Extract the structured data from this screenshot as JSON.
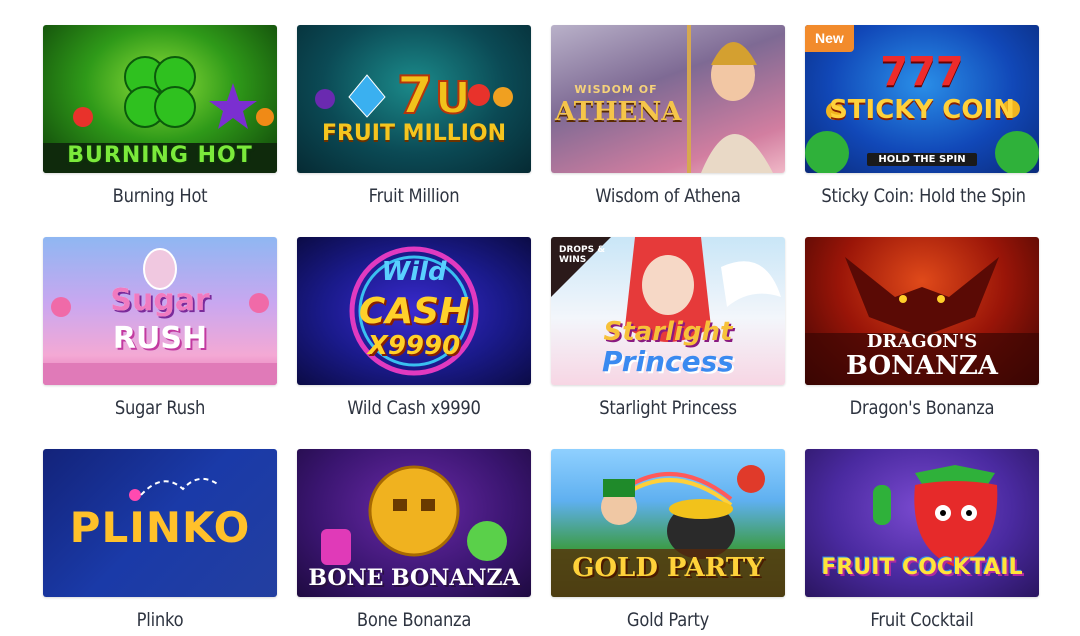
{
  "games": [
    {
      "title": "Burning Hot",
      "logo": "BURNING HOT",
      "badge": ""
    },
    {
      "title": "Fruit Million",
      "logo": "FRUIT MILLION",
      "badge": ""
    },
    {
      "title": "Wisdom of Athena",
      "logo_top": "WISDOM OF",
      "logo": "ATHENA",
      "badge": ""
    },
    {
      "title": "Sticky Coin: Hold the Spin",
      "logo_top": "777",
      "logo": "STICKY COIN",
      "logo_sub": "HOLD THE SPIN",
      "badge": "New"
    },
    {
      "title": "Sugar Rush",
      "logo_top": "Sugar",
      "logo": "RUSH",
      "badge": ""
    },
    {
      "title": "Wild Cash x9990",
      "logo_top": "Wild",
      "logo": "CASH",
      "logo_sub": "X9990",
      "badge": ""
    },
    {
      "title": "Starlight Princess",
      "logo_top": "Starlight",
      "logo": "Princess",
      "logo_corner": "DROPS & WINS",
      "badge": ""
    },
    {
      "title": "Dragon's Bonanza",
      "logo_top": "DRAGON'S",
      "logo": "BONANZA",
      "badge": ""
    },
    {
      "title": "Plinko",
      "logo": "PLINKO",
      "badge": ""
    },
    {
      "title": "Bone Bonanza",
      "logo": "BONE BONANZA",
      "badge": ""
    },
    {
      "title": "Gold Party",
      "logo": "GOLD PARTY",
      "badge": ""
    },
    {
      "title": "Fruit Cocktail",
      "logo": "FRUIT COCKTAIL",
      "badge": ""
    }
  ]
}
